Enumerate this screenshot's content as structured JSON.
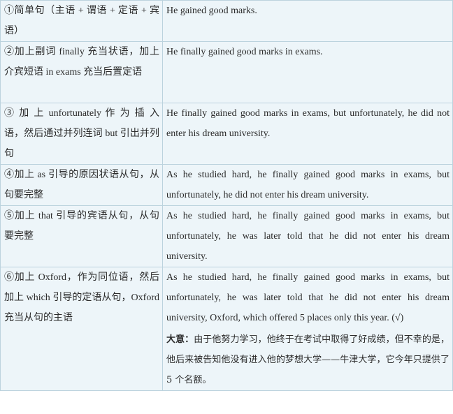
{
  "rows": [
    {
      "step": "①简单句（主语 + 谓语 + 定语 + 宾语）",
      "sentence": "He gained good marks."
    },
    {
      "step": "②加上副词 finally 充当状语，加上介宾短语 in exams 充当后置定语",
      "sentence": "He finally gained good marks in exams."
    },
    {
      "step": "③ 加 上 unfortunately 作 为 插 入 语，然后通过并列连词 but 引出并列句",
      "sentence": "He finally gained good marks in exams, but unfortunately, he did not enter his dream university."
    },
    {
      "step": "④加上 as 引导的原因状语从句，从句要完整",
      "sentence": "As he studied hard, he finally gained good marks in exams, but unfortunately, he did not enter his dream university."
    },
    {
      "step": "⑤加上 that 引导的宾语从句，从句要完整",
      "sentence": "As he studied hard, he finally gained good marks in exams, but unfortunately, he was later told that he did not enter his dream university."
    },
    {
      "step": "⑥加上 Oxford，作为同位语，然后加上 which 引导的定语从句，Oxford 充当从句的主语",
      "sentence": "As he studied hard, he finally gained good marks in exams, but unfortunately, he was later told that he did not enter his dream university, Oxford, which offered 5 places only this year. (√)",
      "meaning_label": "大意：",
      "meaning": "由于他努力学习，他终于在考试中取得了好成绩，但不幸的是，他后来被告知他没有进入他的梦想大学——牛津大学，它今年只提供了 5 个名额。"
    }
  ]
}
